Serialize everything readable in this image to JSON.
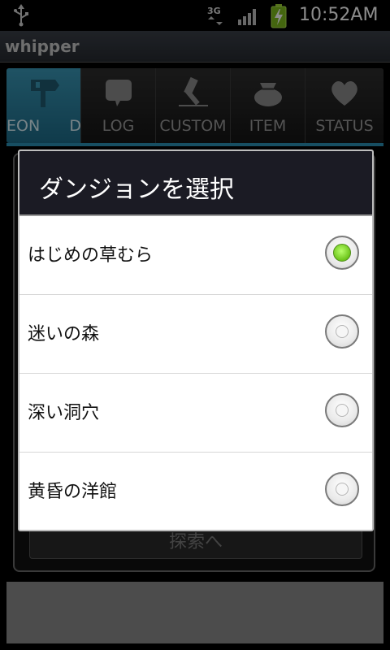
{
  "status_bar": {
    "time": "10:52AM",
    "network_label": "3G",
    "icons": [
      "usb-icon",
      "network-3g-icon",
      "signal-icon",
      "battery-charging-icon"
    ]
  },
  "app": {
    "title": "whipper"
  },
  "tabs": [
    {
      "label": "EON      DU",
      "icon": "signpost-icon",
      "active": true
    },
    {
      "label": "LOG",
      "icon": "speech-bubble-icon",
      "active": false
    },
    {
      "label": "CUSTOM",
      "icon": "hammer-icon",
      "active": false
    },
    {
      "label": "ITEM",
      "icon": "bag-icon",
      "active": false
    },
    {
      "label": "STATUS",
      "icon": "heart-icon",
      "active": false
    }
  ],
  "background": {
    "button_label": "探索へ"
  },
  "dialog": {
    "title": "ダンジョンを選択",
    "options": [
      {
        "label": "はじめの草むら",
        "checked": true
      },
      {
        "label": "迷いの森",
        "checked": false
      },
      {
        "label": "深い洞穴",
        "checked": false
      },
      {
        "label": "黄昏の洋館",
        "checked": false
      }
    ]
  },
  "colors": {
    "accent": "#2b8fb3",
    "radio_checked": "#6cc41a",
    "dialog_header": "#1b1b24"
  }
}
